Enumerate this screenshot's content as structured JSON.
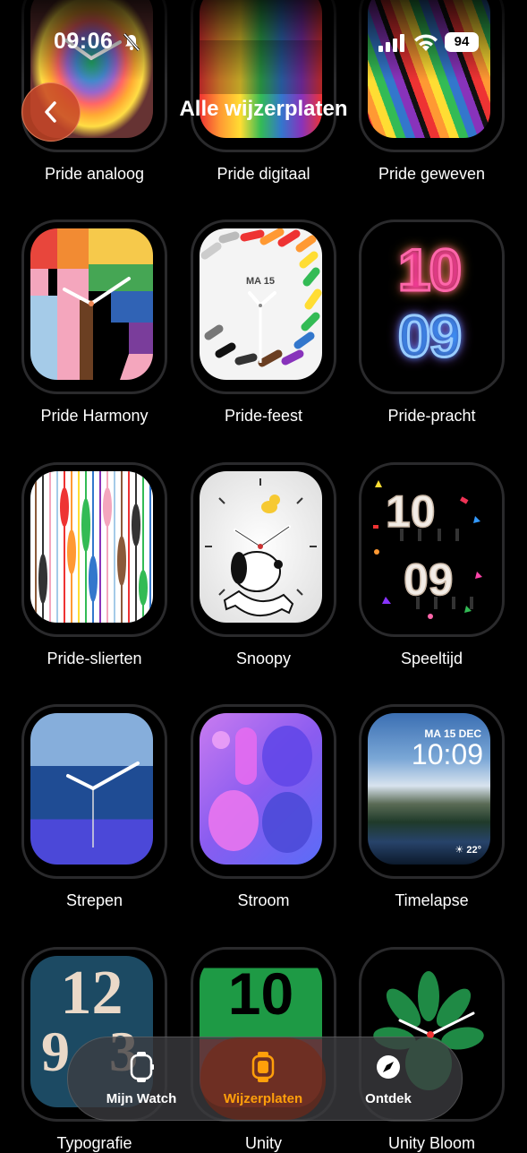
{
  "status": {
    "time": "09:06",
    "battery": "94"
  },
  "nav": {
    "title": "Alle wijzerplaten"
  },
  "faces": [
    {
      "label": "Pride analoog"
    },
    {
      "label": "Pride digitaal"
    },
    {
      "label": "Pride geweven"
    },
    {
      "label": "Pride Harmony"
    },
    {
      "label": "Pride-feest",
      "date": "MA 15"
    },
    {
      "label": "Pride-pracht",
      "hour": "10",
      "minute": "09"
    },
    {
      "label": "Pride-slierten"
    },
    {
      "label": "Snoopy"
    },
    {
      "label": "Speeltijd",
      "hour": "10",
      "minute": "09"
    },
    {
      "label": "Strepen"
    },
    {
      "label": "Stroom"
    },
    {
      "label": "Timelapse",
      "date": "MA 15 DEC",
      "time": "10:09",
      "temp": "22°"
    },
    {
      "label": "Typografie",
      "hour": "12"
    },
    {
      "label": "Unity",
      "hour": "10"
    },
    {
      "label": "Unity Bloom"
    }
  ],
  "tabs": [
    {
      "label": "Mijn Watch",
      "icon": "watch-icon"
    },
    {
      "label": "Wijzerplaten",
      "icon": "watch-face-icon",
      "active": true
    },
    {
      "label": "Ontdek",
      "icon": "compass-icon"
    }
  ],
  "colors": {
    "accent": "#ff9f0a",
    "back_button": "#c84628"
  }
}
